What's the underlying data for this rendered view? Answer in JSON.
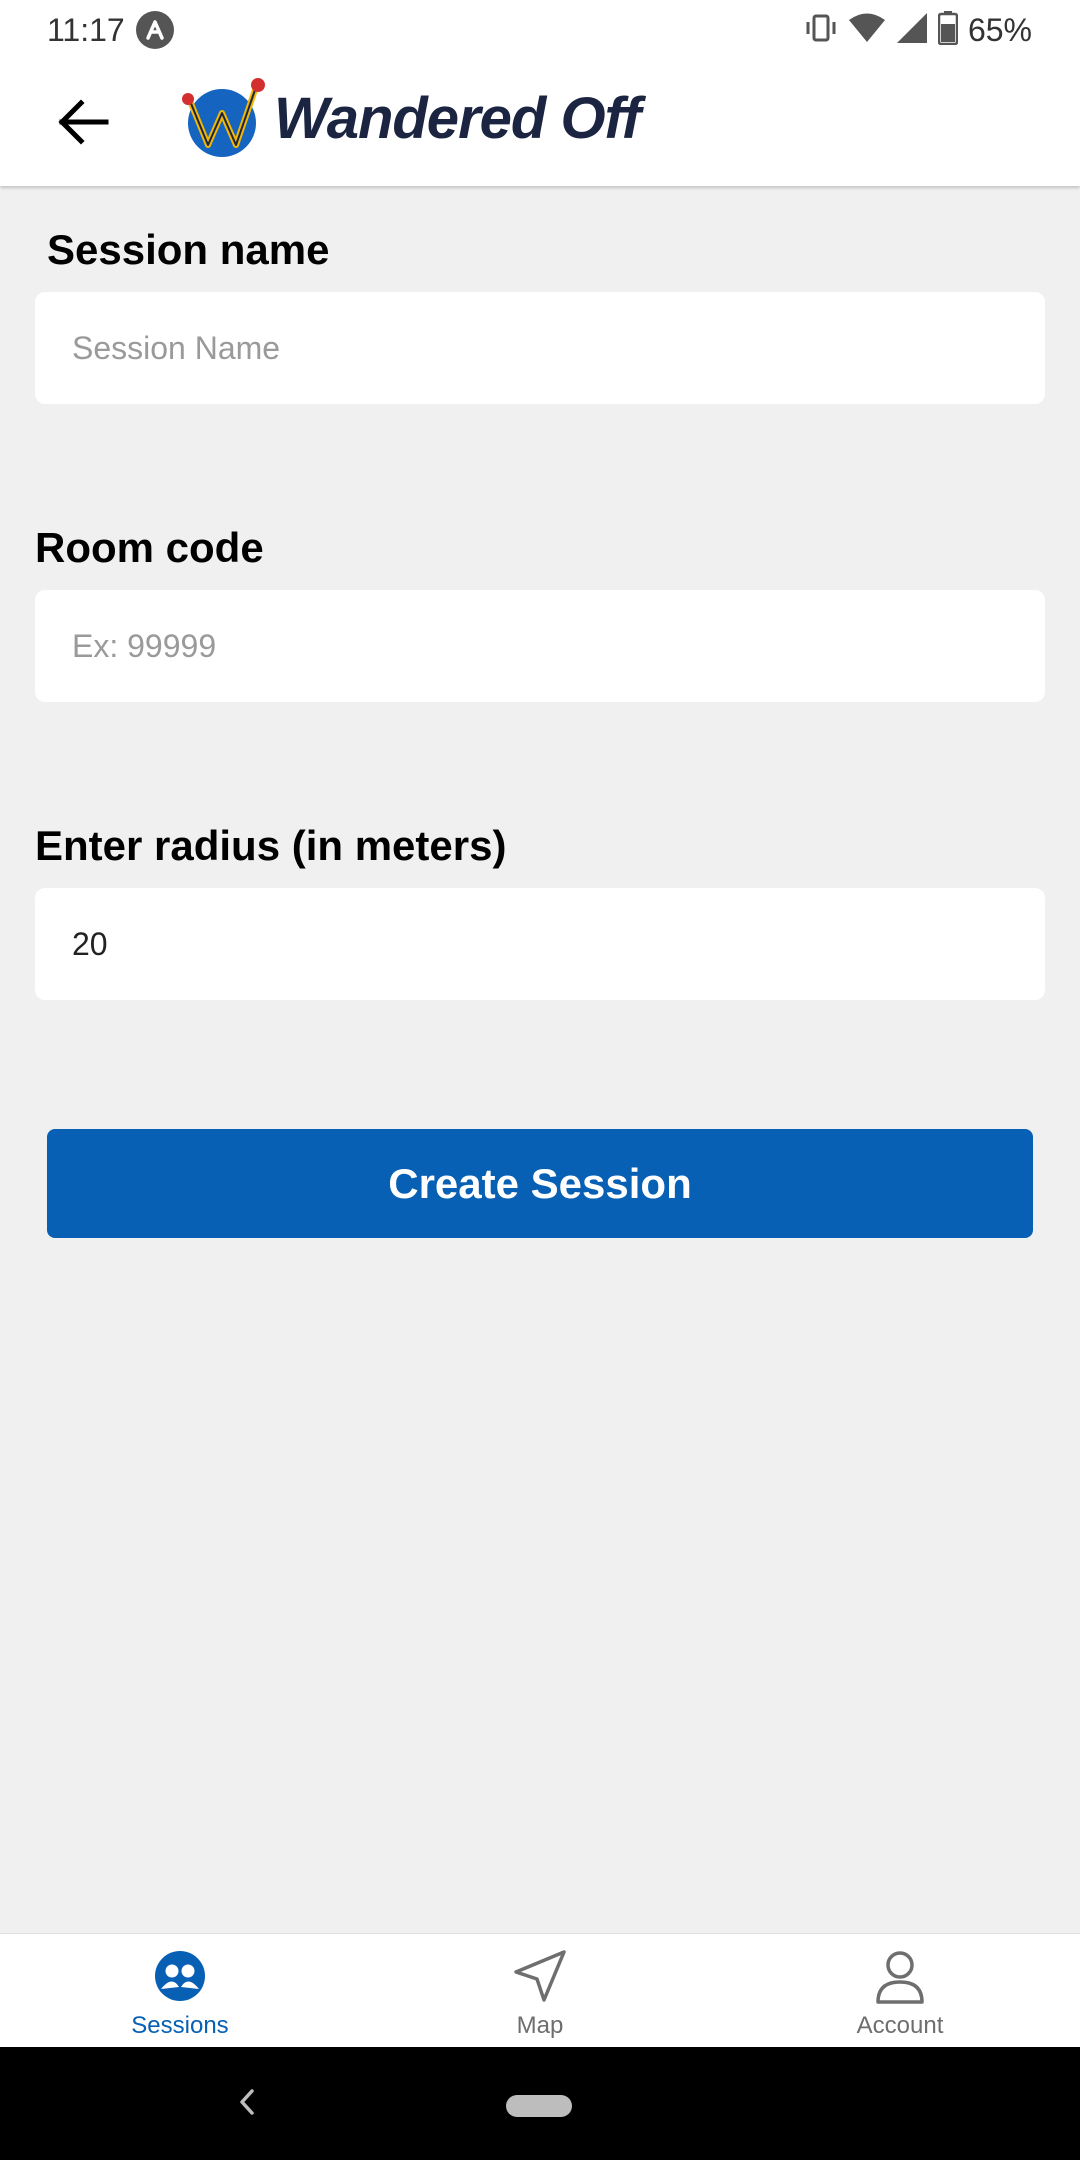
{
  "status_bar": {
    "time": "11:17",
    "battery": "65%",
    "icons": [
      "app-notification-icon",
      "vibrate-icon",
      "wifi-icon",
      "signal-icon",
      "battery-icon"
    ]
  },
  "header": {
    "app_name": "Wandered Off",
    "back_icon": "arrow-left-icon"
  },
  "form": {
    "session_name": {
      "label": "Session name",
      "placeholder": "Session Name",
      "value": ""
    },
    "room_code": {
      "label": "Room code",
      "placeholder": "Ex: 99999",
      "value": ""
    },
    "radius": {
      "label": "Enter radius (in meters)",
      "placeholder": "",
      "value": "20"
    },
    "submit_label": "Create Session"
  },
  "bottom_nav": {
    "active": "Sessions",
    "tabs": [
      {
        "label": "Sessions",
        "icon": "people-icon"
      },
      {
        "label": "Map",
        "icon": "navigation-arrow-icon"
      },
      {
        "label": "Account",
        "icon": "person-icon"
      }
    ]
  },
  "colors": {
    "accent": "#0760b3",
    "background": "#f0f0f0",
    "surface": "#ffffff",
    "logo_text": "#1b2440",
    "logo_circle": "#1565c0",
    "logo_dot": "#d32f2f",
    "logo_check": "#f2b705"
  }
}
